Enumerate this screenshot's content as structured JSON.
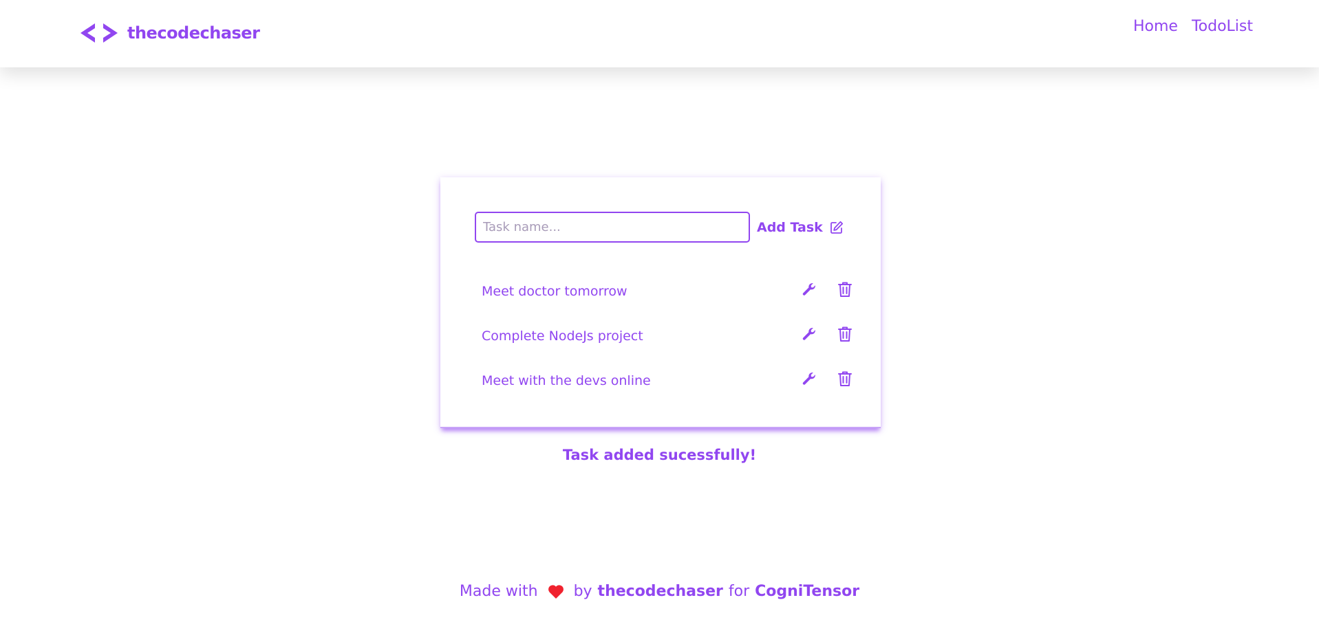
{
  "navbar": {
    "brand_name": "thecodechaser",
    "brand_icon": "code-brackets-icon",
    "links": [
      {
        "label": "Home"
      },
      {
        "label": "TodoList"
      }
    ]
  },
  "todo": {
    "input_placeholder": "Task name...",
    "input_value": "",
    "add_button_label": "Add Task",
    "add_button_icon": "edit-icon",
    "tasks": [
      {
        "label": "Meet doctor tomorrow",
        "edit_icon": "wrench-icon",
        "delete_icon": "trash-icon"
      },
      {
        "label": "Complete NodeJs project",
        "edit_icon": "wrench-icon",
        "delete_icon": "trash-icon"
      },
      {
        "label": "Meet with the devs online",
        "edit_icon": "wrench-icon",
        "delete_icon": "trash-icon"
      }
    ]
  },
  "status_message": "Task added sucessfully!",
  "footer": {
    "made_with": "Made with",
    "heart_icon": "heart-icon",
    "by": "by",
    "author": "thecodechaser",
    "for": "for",
    "org": "CogniTensor"
  },
  "colors": {
    "accent": "#9146f0",
    "heart": "#f0222e",
    "background": "#ffffff"
  }
}
